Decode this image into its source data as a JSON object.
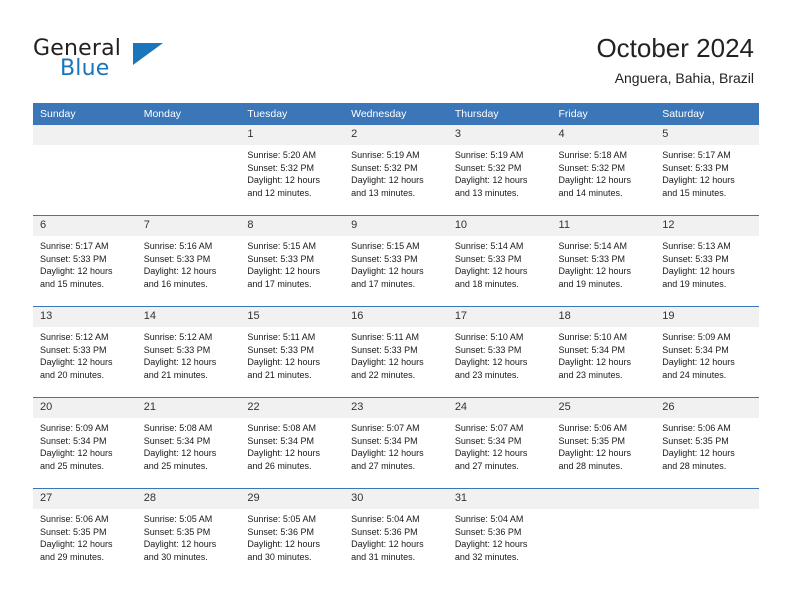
{
  "brand": {
    "name_primary": "General",
    "name_secondary": "Blue",
    "logo_icon": "triangle-icon"
  },
  "header": {
    "title": "October 2024",
    "subtitle": "Anguera, Bahia, Brazil"
  },
  "colors": {
    "accent": "#3a76b8",
    "brand_blue": "#1b75bb",
    "daynum_band": "#f1f1f1",
    "text": "#1a1a1a"
  },
  "calendar": {
    "weekday_headers": [
      "Sunday",
      "Monday",
      "Tuesday",
      "Wednesday",
      "Thursday",
      "Friday",
      "Saturday"
    ],
    "labels": {
      "sunrise": "Sunrise:",
      "sunset": "Sunset:",
      "daylight": "Daylight:"
    },
    "weeks": [
      [
        {
          "day": "",
          "empty": true,
          "sunrise": "",
          "sunset": "",
          "daylight_1": "",
          "daylight_2": ""
        },
        {
          "day": "",
          "empty": true,
          "sunrise": "",
          "sunset": "",
          "daylight_1": "",
          "daylight_2": ""
        },
        {
          "day": "1",
          "empty": false,
          "sunrise": "Sunrise: 5:20 AM",
          "sunset": "Sunset: 5:32 PM",
          "daylight_1": "Daylight: 12 hours",
          "daylight_2": "and 12 minutes."
        },
        {
          "day": "2",
          "empty": false,
          "sunrise": "Sunrise: 5:19 AM",
          "sunset": "Sunset: 5:32 PM",
          "daylight_1": "Daylight: 12 hours",
          "daylight_2": "and 13 minutes."
        },
        {
          "day": "3",
          "empty": false,
          "sunrise": "Sunrise: 5:19 AM",
          "sunset": "Sunset: 5:32 PM",
          "daylight_1": "Daylight: 12 hours",
          "daylight_2": "and 13 minutes."
        },
        {
          "day": "4",
          "empty": false,
          "sunrise": "Sunrise: 5:18 AM",
          "sunset": "Sunset: 5:32 PM",
          "daylight_1": "Daylight: 12 hours",
          "daylight_2": "and 14 minutes."
        },
        {
          "day": "5",
          "empty": false,
          "sunrise": "Sunrise: 5:17 AM",
          "sunset": "Sunset: 5:33 PM",
          "daylight_1": "Daylight: 12 hours",
          "daylight_2": "and 15 minutes."
        }
      ],
      [
        {
          "day": "6",
          "empty": false,
          "sunrise": "Sunrise: 5:17 AM",
          "sunset": "Sunset: 5:33 PM",
          "daylight_1": "Daylight: 12 hours",
          "daylight_2": "and 15 minutes."
        },
        {
          "day": "7",
          "empty": false,
          "sunrise": "Sunrise: 5:16 AM",
          "sunset": "Sunset: 5:33 PM",
          "daylight_1": "Daylight: 12 hours",
          "daylight_2": "and 16 minutes."
        },
        {
          "day": "8",
          "empty": false,
          "sunrise": "Sunrise: 5:15 AM",
          "sunset": "Sunset: 5:33 PM",
          "daylight_1": "Daylight: 12 hours",
          "daylight_2": "and 17 minutes."
        },
        {
          "day": "9",
          "empty": false,
          "sunrise": "Sunrise: 5:15 AM",
          "sunset": "Sunset: 5:33 PM",
          "daylight_1": "Daylight: 12 hours",
          "daylight_2": "and 17 minutes."
        },
        {
          "day": "10",
          "empty": false,
          "sunrise": "Sunrise: 5:14 AM",
          "sunset": "Sunset: 5:33 PM",
          "daylight_1": "Daylight: 12 hours",
          "daylight_2": "and 18 minutes."
        },
        {
          "day": "11",
          "empty": false,
          "sunrise": "Sunrise: 5:14 AM",
          "sunset": "Sunset: 5:33 PM",
          "daylight_1": "Daylight: 12 hours",
          "daylight_2": "and 19 minutes."
        },
        {
          "day": "12",
          "empty": false,
          "sunrise": "Sunrise: 5:13 AM",
          "sunset": "Sunset: 5:33 PM",
          "daylight_1": "Daylight: 12 hours",
          "daylight_2": "and 19 minutes."
        }
      ],
      [
        {
          "day": "13",
          "empty": false,
          "sunrise": "Sunrise: 5:12 AM",
          "sunset": "Sunset: 5:33 PM",
          "daylight_1": "Daylight: 12 hours",
          "daylight_2": "and 20 minutes."
        },
        {
          "day": "14",
          "empty": false,
          "sunrise": "Sunrise: 5:12 AM",
          "sunset": "Sunset: 5:33 PM",
          "daylight_1": "Daylight: 12 hours",
          "daylight_2": "and 21 minutes."
        },
        {
          "day": "15",
          "empty": false,
          "sunrise": "Sunrise: 5:11 AM",
          "sunset": "Sunset: 5:33 PM",
          "daylight_1": "Daylight: 12 hours",
          "daylight_2": "and 21 minutes."
        },
        {
          "day": "16",
          "empty": false,
          "sunrise": "Sunrise: 5:11 AM",
          "sunset": "Sunset: 5:33 PM",
          "daylight_1": "Daylight: 12 hours",
          "daylight_2": "and 22 minutes."
        },
        {
          "day": "17",
          "empty": false,
          "sunrise": "Sunrise: 5:10 AM",
          "sunset": "Sunset: 5:33 PM",
          "daylight_1": "Daylight: 12 hours",
          "daylight_2": "and 23 minutes."
        },
        {
          "day": "18",
          "empty": false,
          "sunrise": "Sunrise: 5:10 AM",
          "sunset": "Sunset: 5:34 PM",
          "daylight_1": "Daylight: 12 hours",
          "daylight_2": "and 23 minutes."
        },
        {
          "day": "19",
          "empty": false,
          "sunrise": "Sunrise: 5:09 AM",
          "sunset": "Sunset: 5:34 PM",
          "daylight_1": "Daylight: 12 hours",
          "daylight_2": "and 24 minutes."
        }
      ],
      [
        {
          "day": "20",
          "empty": false,
          "sunrise": "Sunrise: 5:09 AM",
          "sunset": "Sunset: 5:34 PM",
          "daylight_1": "Daylight: 12 hours",
          "daylight_2": "and 25 minutes."
        },
        {
          "day": "21",
          "empty": false,
          "sunrise": "Sunrise: 5:08 AM",
          "sunset": "Sunset: 5:34 PM",
          "daylight_1": "Daylight: 12 hours",
          "daylight_2": "and 25 minutes."
        },
        {
          "day": "22",
          "empty": false,
          "sunrise": "Sunrise: 5:08 AM",
          "sunset": "Sunset: 5:34 PM",
          "daylight_1": "Daylight: 12 hours",
          "daylight_2": "and 26 minutes."
        },
        {
          "day": "23",
          "empty": false,
          "sunrise": "Sunrise: 5:07 AM",
          "sunset": "Sunset: 5:34 PM",
          "daylight_1": "Daylight: 12 hours",
          "daylight_2": "and 27 minutes."
        },
        {
          "day": "24",
          "empty": false,
          "sunrise": "Sunrise: 5:07 AM",
          "sunset": "Sunset: 5:34 PM",
          "daylight_1": "Daylight: 12 hours",
          "daylight_2": "and 27 minutes."
        },
        {
          "day": "25",
          "empty": false,
          "sunrise": "Sunrise: 5:06 AM",
          "sunset": "Sunset: 5:35 PM",
          "daylight_1": "Daylight: 12 hours",
          "daylight_2": "and 28 minutes."
        },
        {
          "day": "26",
          "empty": false,
          "sunrise": "Sunrise: 5:06 AM",
          "sunset": "Sunset: 5:35 PM",
          "daylight_1": "Daylight: 12 hours",
          "daylight_2": "and 28 minutes."
        }
      ],
      [
        {
          "day": "27",
          "empty": false,
          "sunrise": "Sunrise: 5:06 AM",
          "sunset": "Sunset: 5:35 PM",
          "daylight_1": "Daylight: 12 hours",
          "daylight_2": "and 29 minutes."
        },
        {
          "day": "28",
          "empty": false,
          "sunrise": "Sunrise: 5:05 AM",
          "sunset": "Sunset: 5:35 PM",
          "daylight_1": "Daylight: 12 hours",
          "daylight_2": "and 30 minutes."
        },
        {
          "day": "29",
          "empty": false,
          "sunrise": "Sunrise: 5:05 AM",
          "sunset": "Sunset: 5:36 PM",
          "daylight_1": "Daylight: 12 hours",
          "daylight_2": "and 30 minutes."
        },
        {
          "day": "30",
          "empty": false,
          "sunrise": "Sunrise: 5:04 AM",
          "sunset": "Sunset: 5:36 PM",
          "daylight_1": "Daylight: 12 hours",
          "daylight_2": "and 31 minutes."
        },
        {
          "day": "31",
          "empty": false,
          "sunrise": "Sunrise: 5:04 AM",
          "sunset": "Sunset: 5:36 PM",
          "daylight_1": "Daylight: 12 hours",
          "daylight_2": "and 32 minutes."
        },
        {
          "day": "",
          "empty": true,
          "sunrise": "",
          "sunset": "",
          "daylight_1": "",
          "daylight_2": ""
        },
        {
          "day": "",
          "empty": true,
          "sunrise": "",
          "sunset": "",
          "daylight_1": "",
          "daylight_2": ""
        }
      ]
    ]
  }
}
